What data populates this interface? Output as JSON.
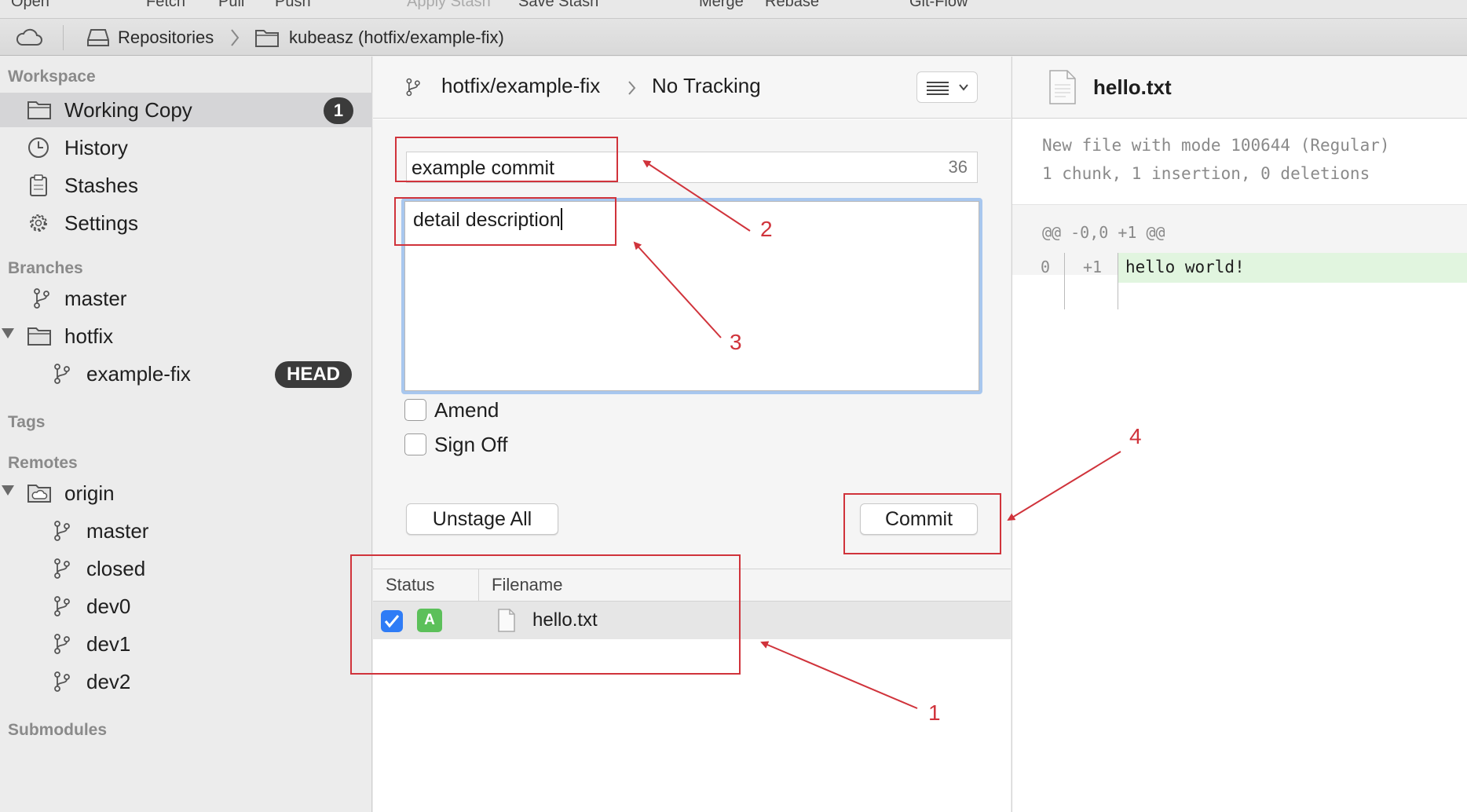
{
  "toolbar": {
    "items": [
      "Open",
      "Fetch",
      "Pull",
      "Push",
      "Apply Stash",
      "Save Stash",
      "Merge",
      "Rebase",
      "Git-Flow"
    ]
  },
  "breadcrumb": {
    "repositories": "Repositories",
    "repo": "kubeasz (hotfix/example-fix)"
  },
  "sidebar": {
    "workspace_header": "Workspace",
    "workspace": [
      {
        "label": "Working Copy",
        "badge": "1",
        "icon": "folder-icon"
      },
      {
        "label": "History",
        "icon": "clock-icon"
      },
      {
        "label": "Stashes",
        "icon": "clipboard-icon"
      },
      {
        "label": "Settings",
        "icon": "gear-icon"
      }
    ],
    "branches_header": "Branches",
    "branches": {
      "master": "master",
      "hotfix": "hotfix",
      "example_fix": "example-fix",
      "head_badge": "HEAD"
    },
    "tags_header": "Tags",
    "remotes_header": "Remotes",
    "remotes": {
      "origin": "origin",
      "branches": [
        "master",
        "closed",
        "dev0",
        "dev1",
        "dev2"
      ]
    },
    "submodules_header": "Submodules"
  },
  "commit_panel": {
    "branch": "hotfix/example-fix",
    "tracking": "No Tracking",
    "summary_value": "example commit",
    "summary_count": "36",
    "description_value": "detail description",
    "amend_label": "Amend",
    "signoff_label": "Sign Off",
    "unstage_all_label": "Unstage All",
    "commit_label": "Commit",
    "table": {
      "col_status": "Status",
      "col_filename": "Filename",
      "rows": [
        {
          "checked": true,
          "status": "A",
          "filename": "hello.txt"
        }
      ]
    }
  },
  "diff_panel": {
    "filename": "hello.txt",
    "meta_line1": "New file with mode 100644 (Regular)",
    "meta_line2": "1 chunk, 1 insertion, 0 deletions",
    "hunk_header": "@@ -0,0 +1 @@",
    "old_line_no": "0",
    "new_line_no": "+1",
    "line_text": "hello world!"
  },
  "annotations": {
    "n1": "1",
    "n2": "2",
    "n3": "3",
    "n4": "4"
  },
  "colors": {
    "annotation_red": "#d0333b",
    "selection_blue": "#2f7cf6",
    "status_added_green": "#5cc05a",
    "added_line_bg": "#e1f5df",
    "focus_ring": "#a8c7ee"
  }
}
